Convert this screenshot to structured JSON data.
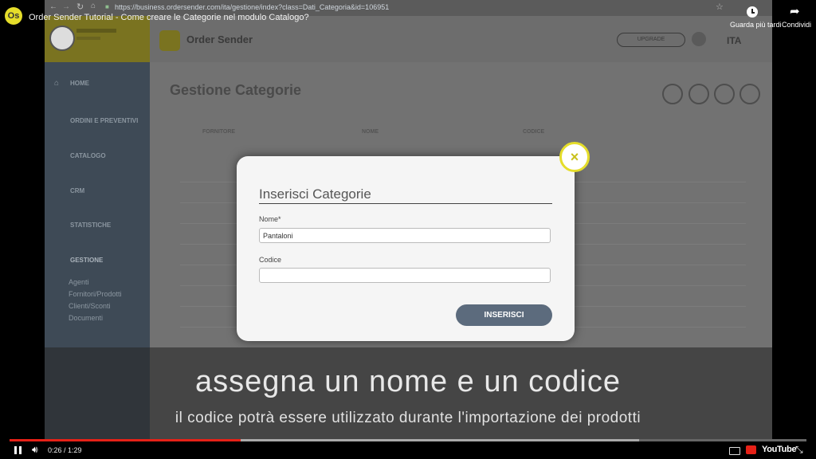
{
  "video": {
    "title": "Order Sender Tutorial - Come creare le Categorie nel modulo Catalogo?",
    "channel_logo_text": "Os",
    "watch_later_label": "Guarda più tardi",
    "share_label": "Condividi",
    "time_display": "0:26 / 1:29",
    "progress": 0.29,
    "buffered": 0.79,
    "youtube_label": "YouTube"
  },
  "browser": {
    "url": "https://business.ordersender.com/ita/gestione/index?class=Dati_Categoria&id=106951"
  },
  "app": {
    "brand": "Order Sender",
    "upgrade_label": "UPGRADE",
    "language": "ITA",
    "page_title": "Gestione Categorie",
    "sidebar_items": [
      "HOME",
      "ORDINI E PREVENTIVI",
      "CATALOGO",
      "CRM",
      "STATISTICHE",
      "GESTIONE"
    ],
    "sidebar_subitems": [
      "Agenti",
      "Fornitori/Prodotti",
      "Clienti/Sconti",
      "Documenti"
    ],
    "table_headers": [
      "FORNITORE",
      "NOME",
      "CODICE"
    ]
  },
  "modal": {
    "title": "Inserisci Categorie",
    "name_label": "Nome*",
    "name_value": "Pantaloni",
    "code_label": "Codice",
    "code_value": "",
    "submit_label": "INSERISCI",
    "close_symbol": "×"
  },
  "captions": {
    "line1": "assegna un nome e un codice",
    "line2": "il codice potrà essere utilizzato durante l'importazione dei prodotti"
  },
  "colors": {
    "accent_yellow": "#e5dd2a",
    "button_slate": "#5c6b7d",
    "progress_red": "#e62117"
  }
}
